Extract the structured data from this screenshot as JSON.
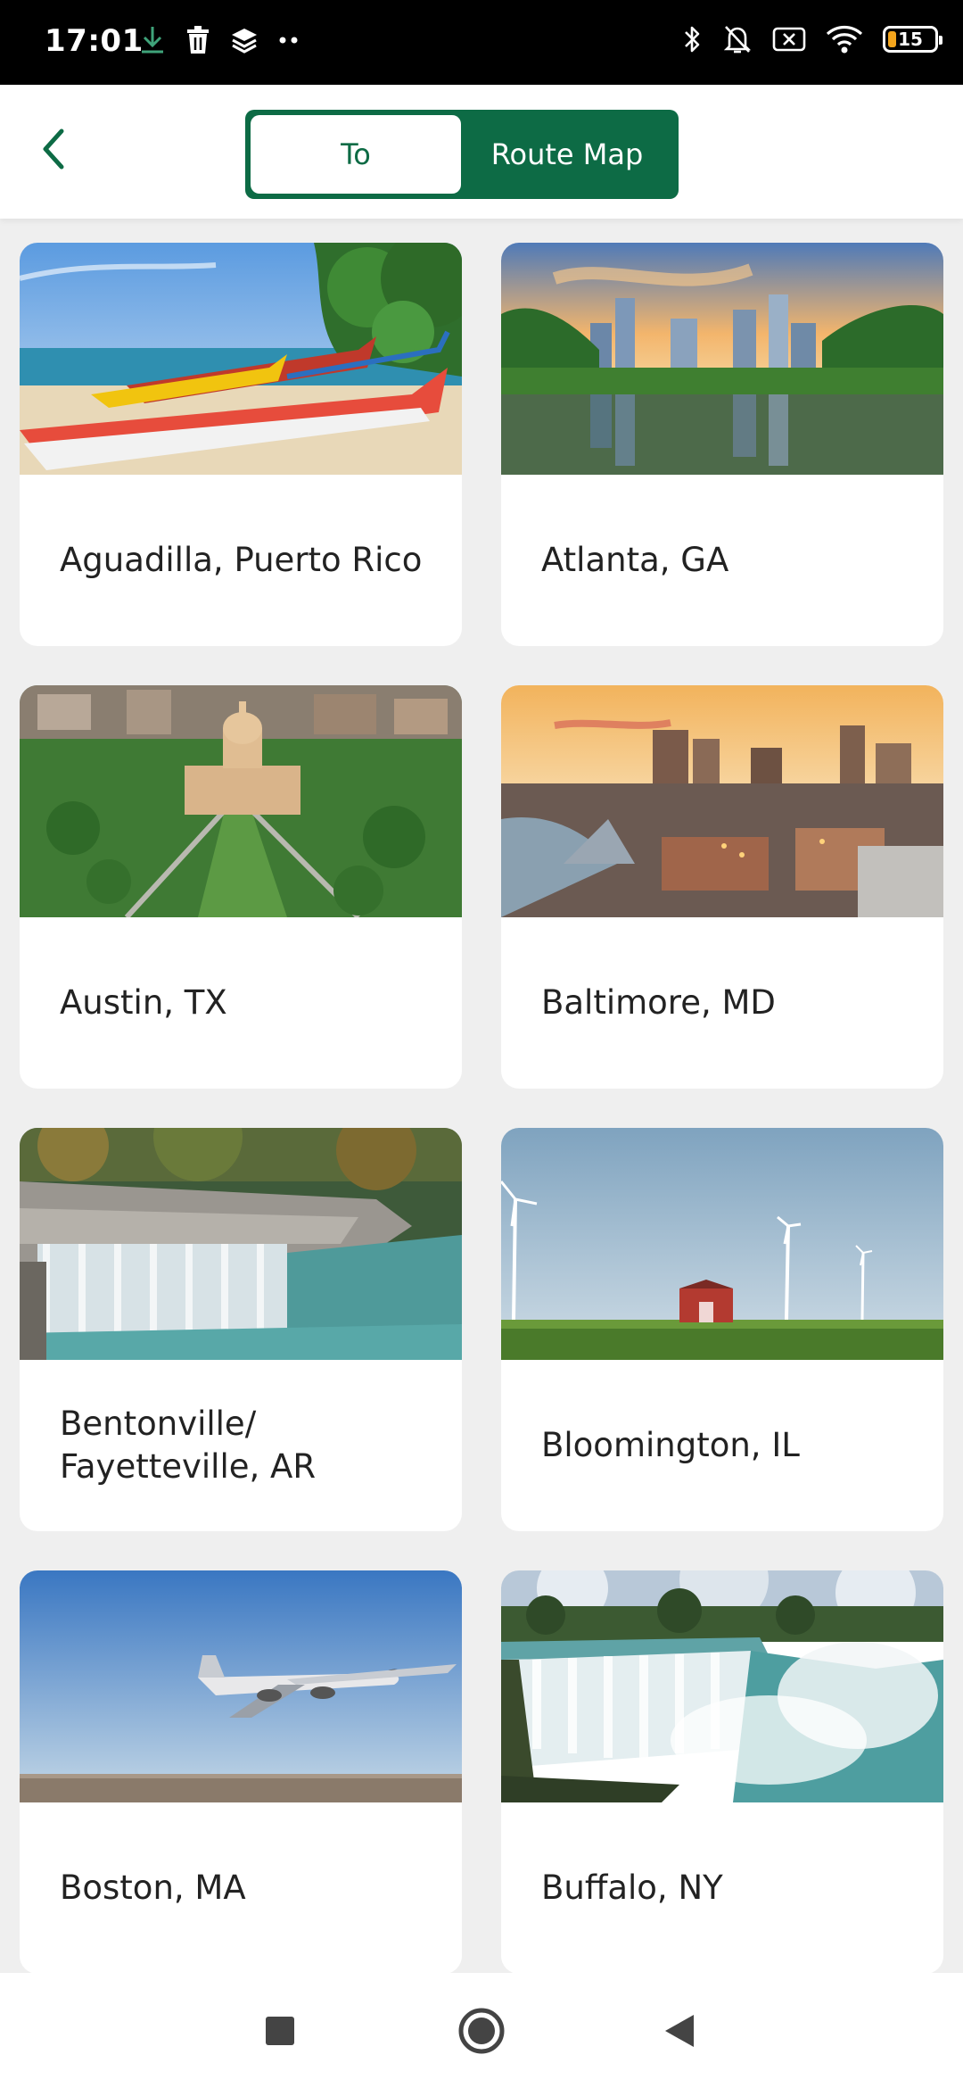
{
  "status_bar": {
    "time": "17:01",
    "battery_level": "15",
    "left_icons": [
      "download-icon",
      "delete-icon",
      "stack-icon",
      "more-dots-icon"
    ],
    "right_icons": [
      "bluetooth-icon",
      "bell-off-icon",
      "no-sim-icon",
      "wifi-icon",
      "battery-icon"
    ]
  },
  "header": {
    "back_icon": "chevron-left-icon",
    "tabs": [
      {
        "label": "To",
        "selected": true
      },
      {
        "label": "Route Map",
        "selected": false
      }
    ]
  },
  "colors": {
    "brand_green": "#0d6b45",
    "background": "#efefef",
    "card": "#ffffff",
    "battery_low": "#f4a51c"
  },
  "destinations": [
    {
      "label": "Aguadilla, Puerto Rico",
      "image": "beach-boats-photo"
    },
    {
      "label": "Atlanta, GA",
      "image": "skyline-lake-photo"
    },
    {
      "label": "Austin, TX",
      "image": "capitol-aerial-photo"
    },
    {
      "label": "Baltimore, MD",
      "image": "harbor-sunset-photo"
    },
    {
      "label": "Bentonville/ Fayetteville, AR",
      "image": "waterfall-photo"
    },
    {
      "label": "Bloomington, IL",
      "image": "wind-turbines-barn-photo"
    },
    {
      "label": "Boston, MA",
      "image": "airplane-photo"
    },
    {
      "label": "Buffalo, NY",
      "image": "niagara-falls-photo"
    }
  ],
  "nav_bar": {
    "buttons": [
      "recents-square-icon",
      "home-circle-icon",
      "back-triangle-icon"
    ]
  }
}
